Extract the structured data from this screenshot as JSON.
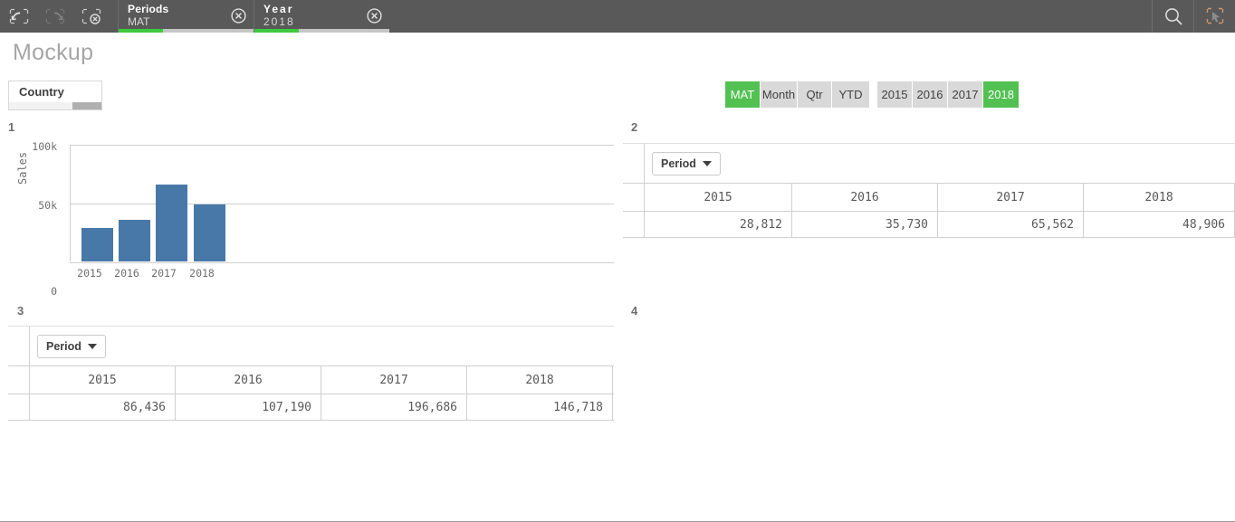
{
  "selection_bar": {
    "tools": [
      {
        "name": "step-back-icon",
        "label": "Step back",
        "enabled": true
      },
      {
        "name": "step-forward-icon",
        "label": "Step forward",
        "enabled": false
      },
      {
        "name": "clear-selections-icon",
        "label": "Clear all selections",
        "enabled": true
      }
    ],
    "chips": [
      {
        "field": "Periods",
        "value": "MAT",
        "selected_ratio": 33,
        "clear_label": "Clear selection"
      },
      {
        "field": "Year",
        "value": "2018",
        "selected_ratio": 33,
        "clear_label": "Clear selection"
      }
    ],
    "right_tools": [
      {
        "name": "search-icon",
        "label": "Smart search"
      },
      {
        "name": "selections-tool-icon",
        "label": "Selections tool"
      }
    ]
  },
  "sheet": {
    "title": "Mockup"
  },
  "filter_pane": {
    "title": "Country"
  },
  "period_buttons": {
    "options": [
      "MAT",
      "Month",
      "Qtr",
      "YTD"
    ],
    "selected": "MAT"
  },
  "year_buttons": {
    "options": [
      "2015",
      "2016",
      "2017",
      "2018"
    ],
    "selected": "2018"
  },
  "panels": [
    {
      "label": "1"
    },
    {
      "label": "2"
    },
    {
      "label": "3"
    },
    {
      "label": "4"
    }
  ],
  "chart_data": {
    "type": "bar",
    "title": "",
    "xlabel": "",
    "ylabel": "Sales",
    "categories": [
      "2015",
      "2016",
      "2017",
      "2018"
    ],
    "values": [
      28812,
      35730,
      65562,
      48906
    ],
    "ylim": [
      0,
      100000
    ],
    "ytick_labels": [
      "0",
      "50k",
      "100k"
    ],
    "ytick_values": [
      0,
      50000,
      100000
    ],
    "grid": true,
    "legend": "none",
    "bar_color": "#4878a8"
  },
  "table_panel2": {
    "dimension_label": "Period",
    "columns": [
      "2015",
      "2016",
      "2017",
      "2018"
    ],
    "rows": [
      {
        "values": [
          "28,812",
          "35,730",
          "65,562",
          "48,906"
        ]
      }
    ]
  },
  "table_panel3": {
    "dimension_label": "Period",
    "columns": [
      "2015",
      "2016",
      "2017",
      "2018"
    ],
    "rows": [
      {
        "values": [
          "86,436",
          "107,190",
          "196,686",
          "146,718"
        ]
      }
    ]
  },
  "theme": {
    "accent_green": "#52c152",
    "bar_blue": "#4878a8",
    "toolbar_gray": "#595959",
    "title_gray": "#a6a6a6"
  }
}
